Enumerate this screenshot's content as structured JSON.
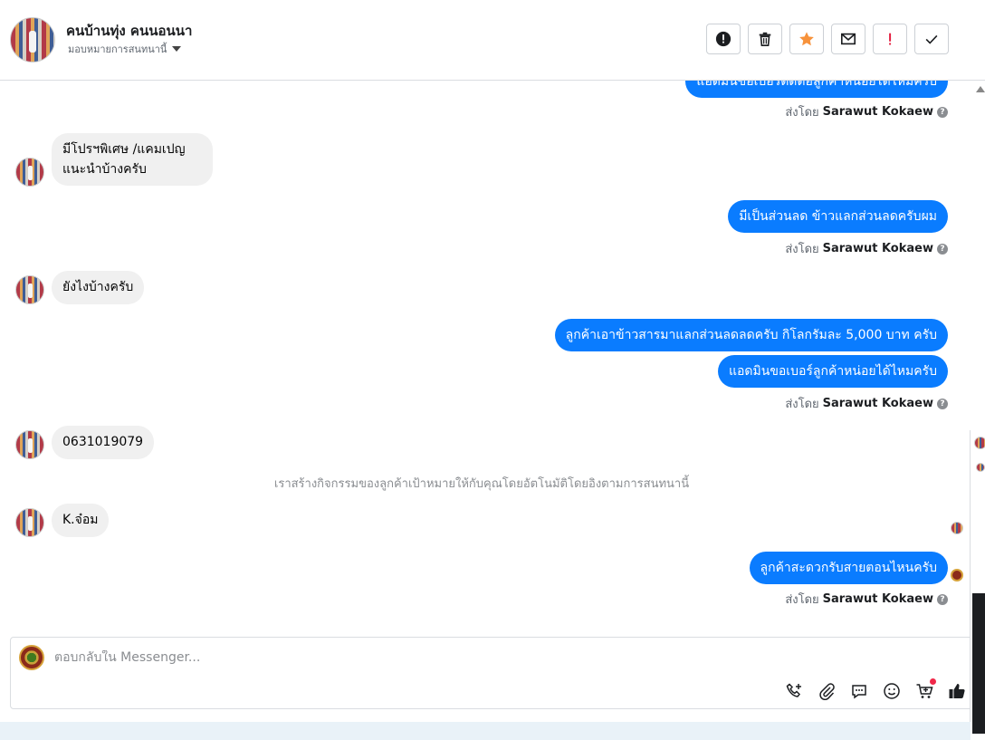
{
  "header": {
    "name": "คนบ้านทุ่ง คนนอนนา",
    "assign_label": "มอบหมายการสนทนานี้"
  },
  "actions": [
    {
      "name": "mark-spam-button",
      "icon": "alert-circle-icon"
    },
    {
      "name": "delete-button",
      "icon": "trash-icon"
    },
    {
      "name": "star-button",
      "icon": "star-icon",
      "color": "#f7923b"
    },
    {
      "name": "mark-unread-button",
      "icon": "envelope-icon"
    },
    {
      "name": "follow-up-button",
      "icon": "exclamation-icon",
      "color": "#e41e3f"
    },
    {
      "name": "mark-done-button",
      "icon": "check-icon"
    }
  ],
  "messages": {
    "out_top": "แอดมินขอเบอร์ติดต่อลูกค้าหน่อยได้ไหมครับ",
    "sent_by_prefix": "ส่งโดย",
    "sent_by_name": "Sarawut Kokaew",
    "in_1": "มีโปรฯพิเศษ /แคมเปญแนะนำบ้างครับ",
    "out_1": "มีเป็นส่วนลด ข้าวแลกส่วนลดครับผม",
    "in_2": "ยังไงบ้างครับ",
    "out_2a": "ลูกค้าเอาข้าวสารมาแลกส่วนลดลดครับ กิโลกรัมละ 5,000 บาท ครับ",
    "out_2b": "แอดมินขอเบอร์ลูกค้าหน่อยได้ไหมครับ",
    "in_3": "0631019079",
    "system_note": "เราสร้างกิจกรรมของลูกค้าเป้าหมายให้กับคุณโดยอัตโนมัติโดยอิงตามการสนทนานี้",
    "in_4": "K.จ๋อม",
    "out_3": "ลูกค้าสะดวกรับสายตอนไหนครับ"
  },
  "composer": {
    "placeholder": "ตอบกลับใน Messenger...",
    "tools": [
      "call-icon",
      "attach-icon",
      "saved-reply-icon",
      "emoji-icon",
      "cart-icon",
      "like-icon"
    ]
  },
  "colors": {
    "outgoing_bubble": "#0a7cff",
    "incoming_bubble": "#f0f0f0"
  }
}
